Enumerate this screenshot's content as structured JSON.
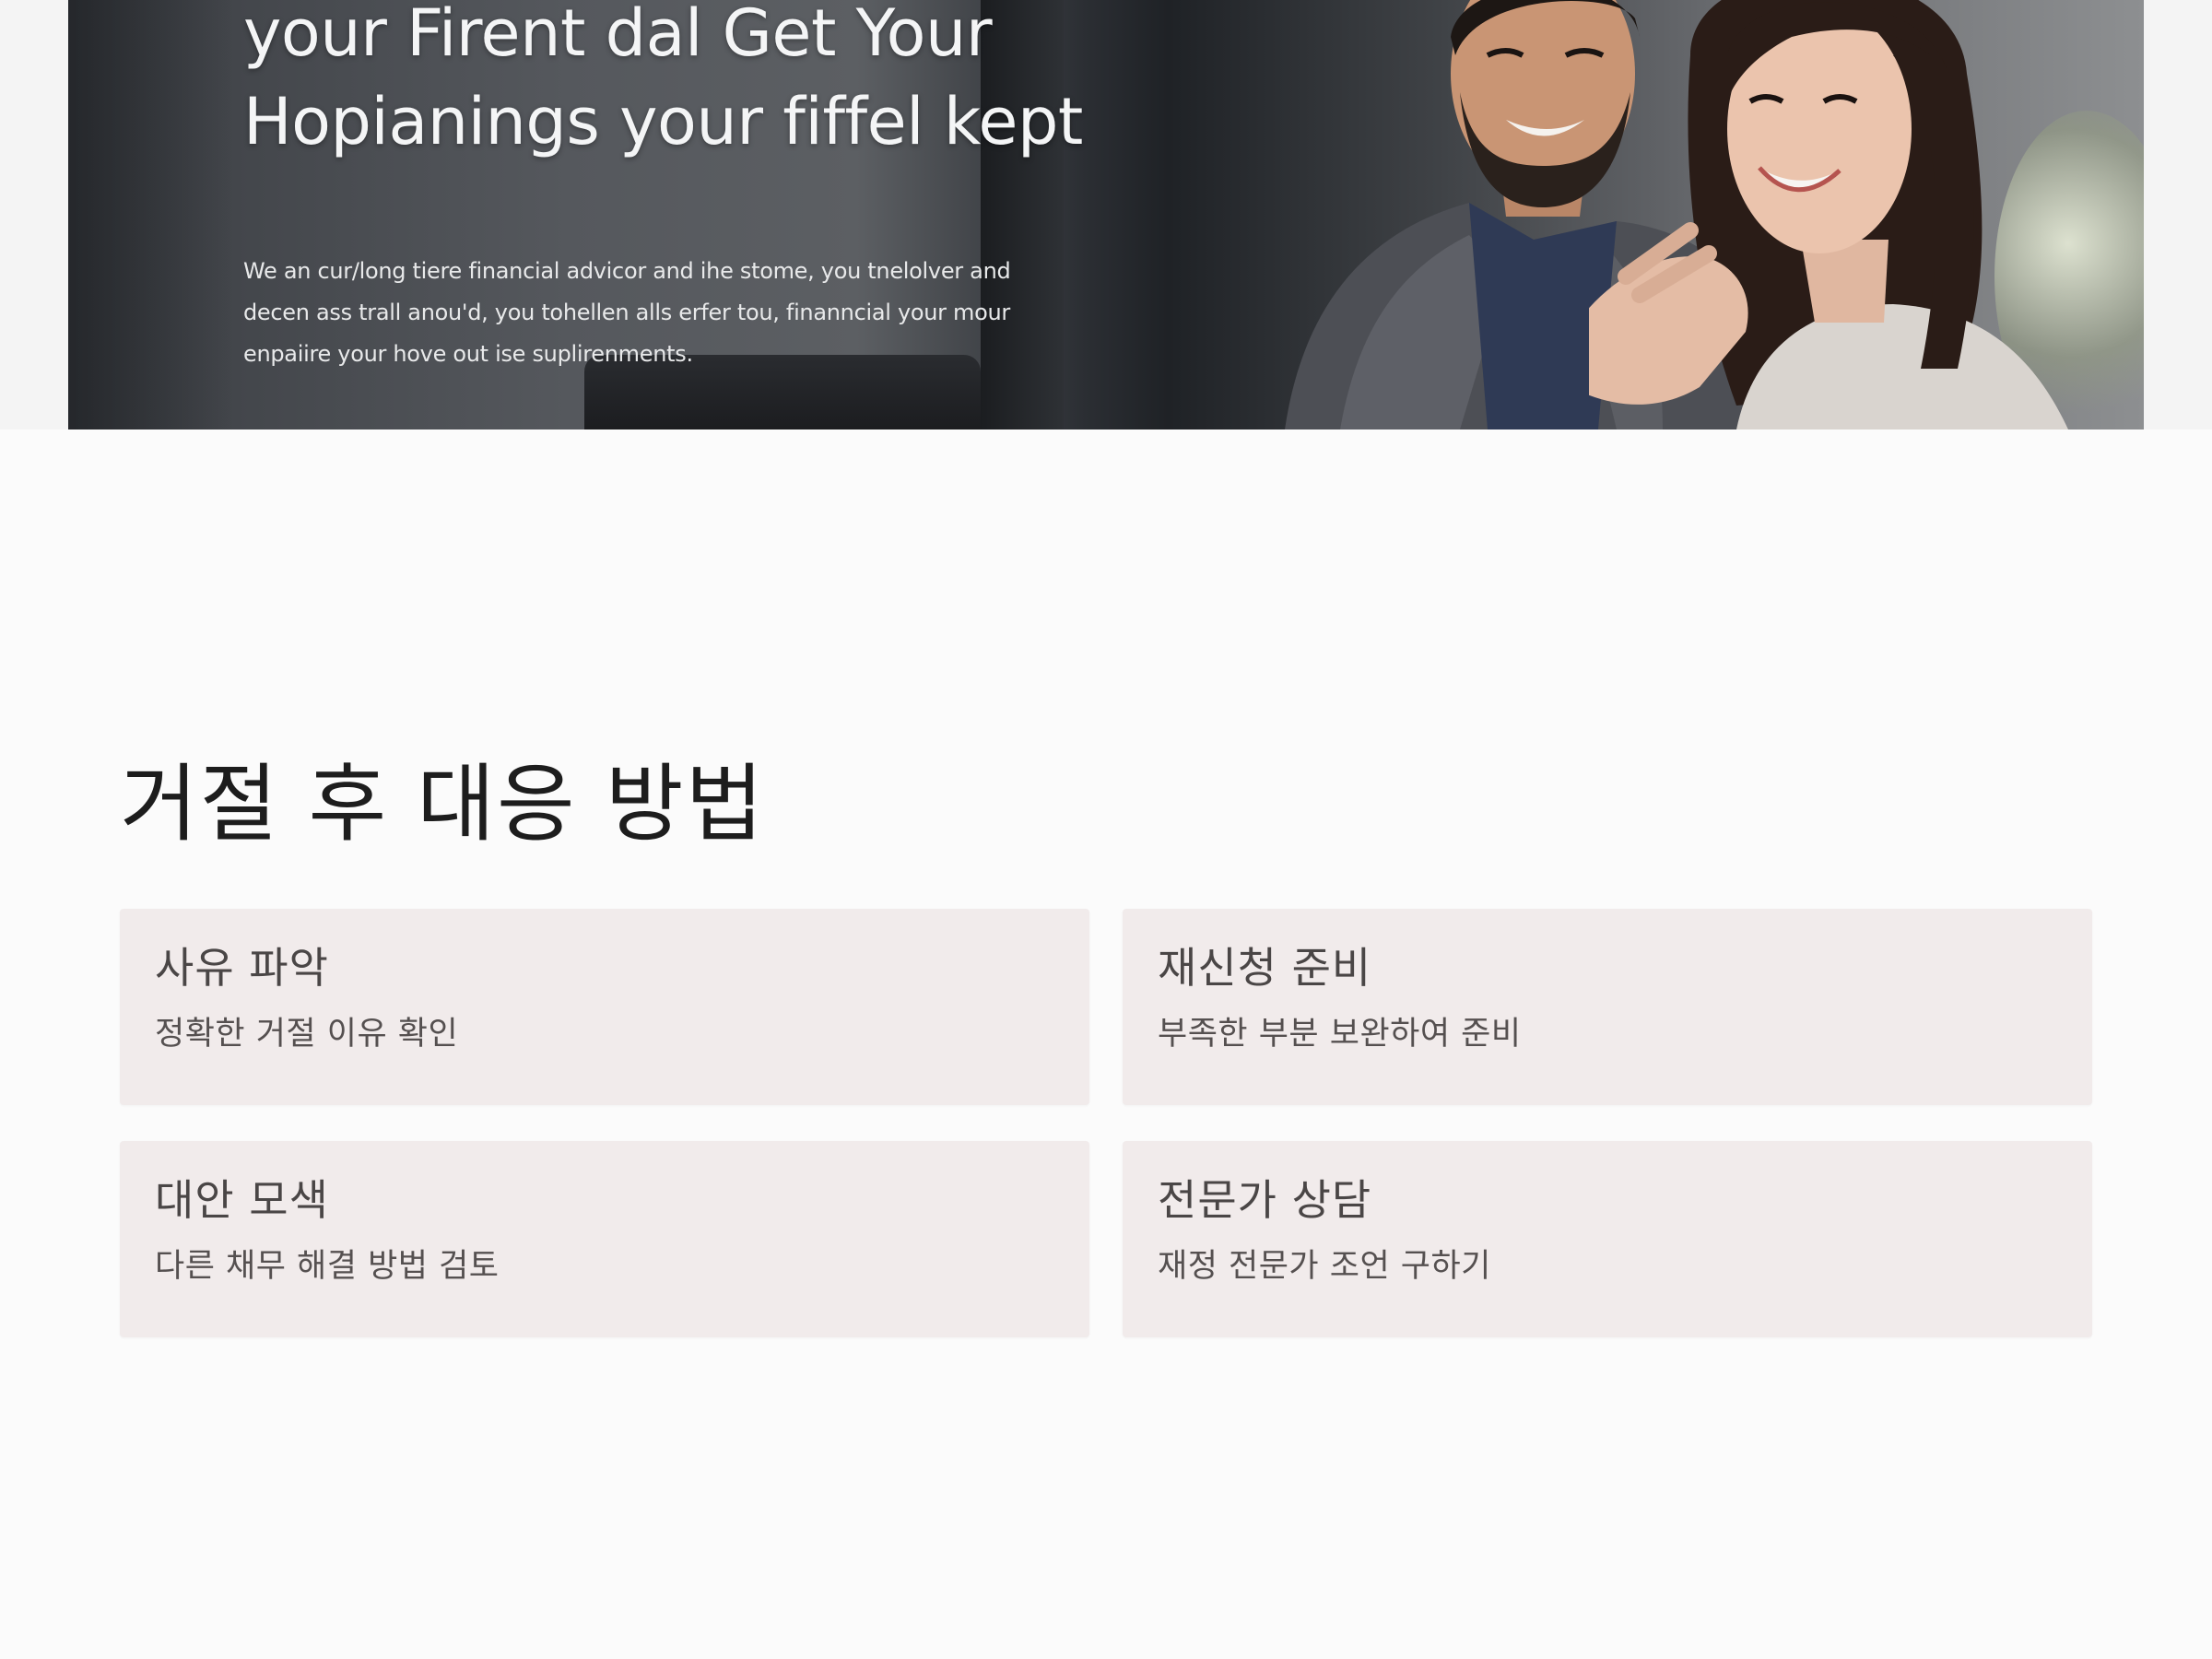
{
  "hero": {
    "headline_line1": "your Firent dal Get Your",
    "headline_line2": "Hopianings your fiffel kept",
    "body_line1": "We an cur/long tiere financial advicor and ihe stome, you tnelolver and",
    "body_line2": "decen ass trall anou'd, you tohellen alls erfer tou, finanncial your mour",
    "body_line3": "enpaiire your hove out ise suplirenments."
  },
  "section": {
    "title": "거절 후 대응 방법"
  },
  "cards": [
    {
      "title": "사유 파악",
      "description": "정확한 거절 이유 확인"
    },
    {
      "title": "재신청 준비",
      "description": "부족한 부분 보완하여 준비"
    },
    {
      "title": "대안 모색",
      "description": "다른 채무 해결 방법 검토"
    },
    {
      "title": "전문가 상담",
      "description": "재정 전문가 조언 구하기"
    }
  ],
  "colors": {
    "page_background": "#fbfbfb",
    "card_background": "#f1ebeb",
    "heading_text": "#1d1d1d",
    "card_title_text": "#4a4646",
    "card_desc_text": "#555050",
    "hero_text": "#f4f5f6"
  }
}
